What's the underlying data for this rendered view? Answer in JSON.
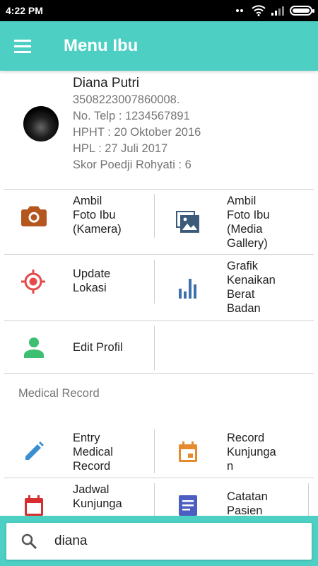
{
  "status_bar": {
    "time": "4:22 PM",
    "icons": [
      "wifi-icon",
      "signal-icon",
      "battery-icon"
    ],
    "battery_level": 1.0
  },
  "app_bar": {
    "title": "Menu Ibu",
    "menu_icon": "hamburger-menu-icon",
    "color": "#4dcfc3"
  },
  "profile": {
    "name": "Diana Putri",
    "id_number": "3508223007860008.",
    "phone": "No. Telp : 1234567891",
    "hpht": "HPHT : 20 Oktober 2016",
    "hpl": "HPL : 27 Juli 2017",
    "poedji_score": "Skor Poedji Rohyati : 6"
  },
  "menu": [
    {
      "label": "Ambil\nFoto Ibu\n(Kamera)",
      "icon": "camera-icon",
      "color": "#b5561f"
    },
    {
      "label": "Ambil\nFoto Ibu\n(Media\nGallery)",
      "icon": "photo-gallery-icon",
      "color": "#3c5a7a"
    },
    {
      "label": "Update\nLokasi",
      "icon": "location-target-icon",
      "color": "#e54a4a"
    },
    {
      "label": "Grafik\nKenaikan\nBerat\nBadan",
      "icon": "bar-chart-icon",
      "color": "#3e6fae"
    },
    {
      "label": "Edit Profil",
      "icon": "person-icon",
      "color": "#3dbf73"
    }
  ],
  "medical_record": {
    "title": "Medical Record",
    "items": [
      {
        "label": "Entry\nMedical\nRecord",
        "icon": "pencil-icon",
        "color": "#3a8fd3"
      },
      {
        "label": "Record\nKunjunga\nn",
        "icon": "calendar-icon",
        "color": "#e68a2e"
      },
      {
        "label": "Jadwal\nKunjunga",
        "icon": "calendar-schedule-icon",
        "color": "#d62f2f"
      },
      {
        "label": "Catatan\nPasien",
        "icon": "note-icon",
        "color": "#4a5fc1"
      }
    ]
  },
  "search": {
    "value": "diana",
    "icon": "search-icon"
  }
}
